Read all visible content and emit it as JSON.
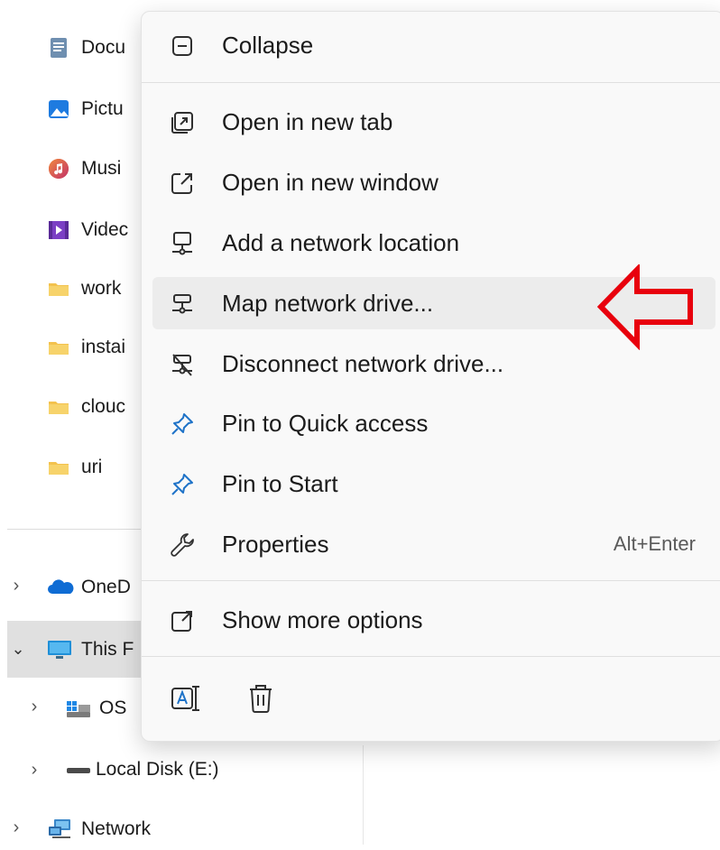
{
  "nav": {
    "items": [
      {
        "label": "Docu",
        "icon": "documents-icon"
      },
      {
        "label": "Pictu",
        "icon": "pictures-icon"
      },
      {
        "label": "Musi",
        "icon": "music-icon"
      },
      {
        "label": "Videc",
        "icon": "videos-icon"
      },
      {
        "label": "work",
        "icon": "folder-icon"
      },
      {
        "label": "instai",
        "icon": "folder-icon"
      },
      {
        "label": "clouc",
        "icon": "folder-icon"
      },
      {
        "label": "uri",
        "icon": "folder-icon"
      }
    ],
    "onedrive": "OneD",
    "this_pc": "This F",
    "os_drive": "OS",
    "local_disk": "Local Disk (E:)",
    "network": "Network"
  },
  "menu": {
    "collapse": "Collapse",
    "open_new_tab": "Open in new tab",
    "open_new_window": "Open in new window",
    "add_network_location": "Add a network location",
    "map_network_drive": "Map network drive...",
    "disconnect_network_drive": "Disconnect network drive...",
    "pin_quick_access": "Pin to Quick access",
    "pin_start": "Pin to Start",
    "properties": "Properties",
    "properties_shortcut": "Alt+Enter",
    "show_more_options": "Show more options"
  },
  "colors": {
    "accent": "#0067c0",
    "annotation": "#e8000d",
    "folder": "#f3c24e"
  }
}
